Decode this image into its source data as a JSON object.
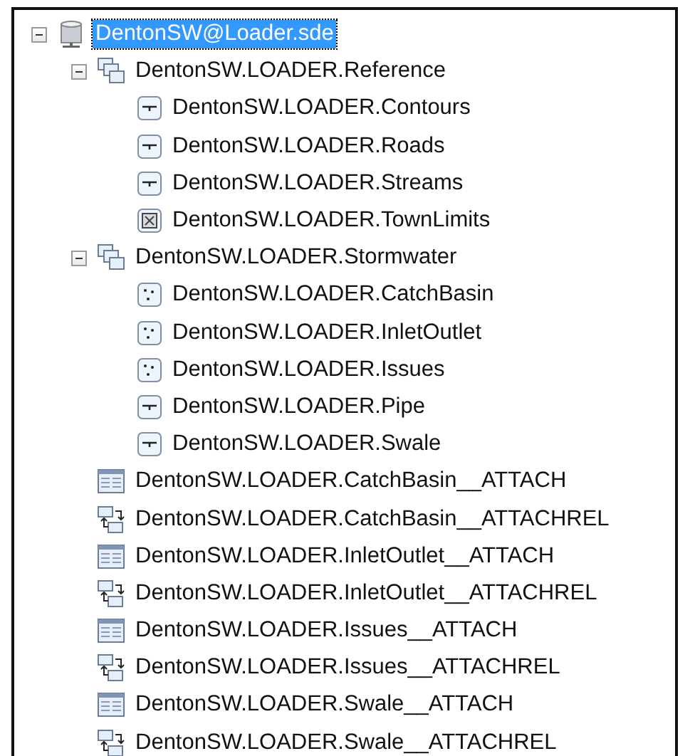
{
  "tree": [
    {
      "label": "DentonSW@Loader.sde",
      "kind": "database",
      "expanded": true,
      "selected": true,
      "children": [
        {
          "label": "DentonSW.LOADER.Reference",
          "kind": "dataset",
          "expanded": true,
          "selected": false,
          "children": [
            {
              "label": "DentonSW.LOADER.Contours",
              "kind": "line",
              "selected": false
            },
            {
              "label": "DentonSW.LOADER.Roads",
              "kind": "line",
              "selected": false
            },
            {
              "label": "DentonSW.LOADER.Streams",
              "kind": "line",
              "selected": false
            },
            {
              "label": "DentonSW.LOADER.TownLimits",
              "kind": "polygon",
              "selected": false
            }
          ]
        },
        {
          "label": "DentonSW.LOADER.Stormwater",
          "kind": "dataset",
          "expanded": true,
          "selected": false,
          "children": [
            {
              "label": "DentonSW.LOADER.CatchBasin",
              "kind": "point",
              "selected": false
            },
            {
              "label": "DentonSW.LOADER.InletOutlet",
              "kind": "point",
              "selected": false
            },
            {
              "label": "DentonSW.LOADER.Issues",
              "kind": "point",
              "selected": false
            },
            {
              "label": "DentonSW.LOADER.Pipe",
              "kind": "line",
              "selected": false
            },
            {
              "label": "DentonSW.LOADER.Swale",
              "kind": "line",
              "selected": false
            }
          ]
        },
        {
          "label": "DentonSW.LOADER.CatchBasin__ATTACH",
          "kind": "table",
          "selected": false
        },
        {
          "label": "DentonSW.LOADER.CatchBasin__ATTACHREL",
          "kind": "relationship",
          "selected": false
        },
        {
          "label": "DentonSW.LOADER.InletOutlet__ATTACH",
          "kind": "table",
          "selected": false
        },
        {
          "label": "DentonSW.LOADER.InletOutlet__ATTACHREL",
          "kind": "relationship",
          "selected": false
        },
        {
          "label": "DentonSW.LOADER.Issues__ATTACH",
          "kind": "table",
          "selected": false
        },
        {
          "label": "DentonSW.LOADER.Issues__ATTACHREL",
          "kind": "relationship",
          "selected": false
        },
        {
          "label": "DentonSW.LOADER.Swale__ATTACH",
          "kind": "table",
          "selected": false
        },
        {
          "label": "DentonSW.LOADER.Swale__ATTACHREL",
          "kind": "relationship",
          "selected": false
        }
      ]
    }
  ]
}
